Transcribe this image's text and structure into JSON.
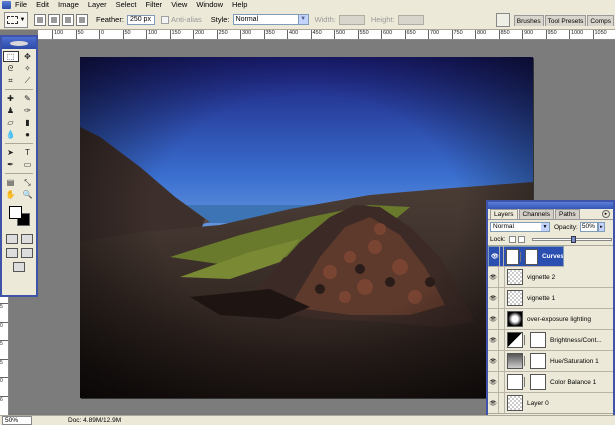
{
  "menu": [
    "File",
    "Edit",
    "Image",
    "Layer",
    "Select",
    "Filter",
    "View",
    "Window",
    "Help"
  ],
  "options": {
    "feather_label": "Feather:",
    "feather_value": "250 px",
    "antialias_label": "Anti-alias",
    "style_label": "Style:",
    "style_value": "Normal",
    "width_label": "Width:",
    "height_label": "Height:"
  },
  "palette_well": [
    "Brushes",
    "Tool Presets",
    "Comps"
  ],
  "ruler_h": [
    "100",
    "50",
    "0",
    "50",
    "100",
    "150",
    "200",
    "250",
    "300",
    "350",
    "400",
    "450",
    "500",
    "550",
    "600",
    "650",
    "700",
    "750",
    "800",
    "850",
    "900",
    "950",
    "1000",
    "1050"
  ],
  "ruler_v": [
    "5",
    "0",
    "5",
    "0",
    "1",
    "5",
    "0",
    "2",
    "5",
    "0",
    "3",
    "5",
    "0",
    "4",
    "5",
    "0",
    "5",
    "5",
    "0",
    "6"
  ],
  "status": {
    "zoom": "50%",
    "doc": "Doc: 4.89M/12.9M"
  },
  "layers_panel": {
    "tabs": [
      "Layers",
      "Channels",
      "Paths"
    ],
    "blend_mode": "Normal",
    "opacity_label": "Opacity:",
    "opacity_value": "50%",
    "opacity_fraction": 0.5,
    "lock_label": "Lock:",
    "layers": [
      {
        "name": "Curves 1",
        "selected": true
      },
      {
        "name": "vignette 2"
      },
      {
        "name": "vignette 1"
      },
      {
        "name": "over-exposure lighting"
      },
      {
        "name": "Brightness/Cont..."
      },
      {
        "name": "Hue/Saturation 1"
      },
      {
        "name": "Color Balance 1"
      },
      {
        "name": "Layer 0"
      }
    ]
  }
}
